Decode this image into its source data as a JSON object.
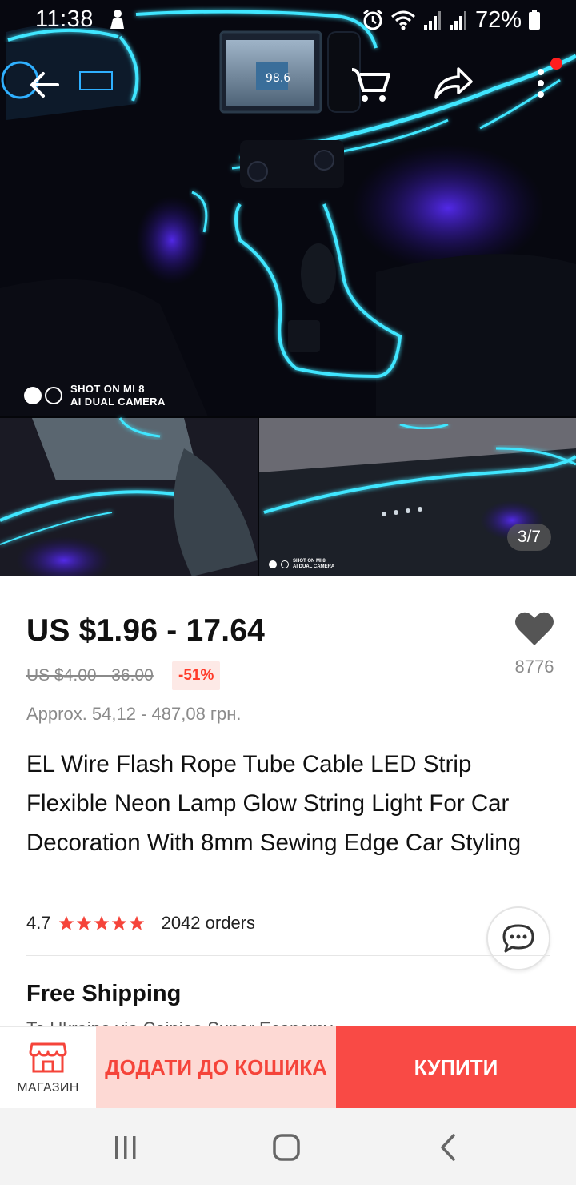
{
  "status_bar": {
    "time": "11:38",
    "battery_percent": "72%"
  },
  "gallery": {
    "counter": "3/7",
    "watermark_line1": "SHOT ON MI 8",
    "watermark_line2": "AI DUAL CAMERA"
  },
  "product": {
    "price": "US $1.96 - 17.64",
    "old_price": "US $4.00 - 36.00",
    "discount": "-51%",
    "approx_price": "Approx. 54,12 - 487,08 грн.",
    "wishlist_count": "8776",
    "title": "EL Wire Flash Rope Tube Cable LED Strip Flexible Neon Lamp Glow String Light For Car Decoration With 8mm Sewing Edge Car Styling",
    "rating": "4.7",
    "stars": 5,
    "orders": "2042 orders",
    "shipping": "Free Shipping",
    "shipping_detail": "To Ukraine via Cainiao Super Economy"
  },
  "action_bar": {
    "store_label": "МАГАЗИН",
    "add_to_cart_label": "ДОДАТИ ДО КОШИКА",
    "buy_label": "КУПИТИ"
  },
  "colors": {
    "accent": "#f94a45",
    "accent_light": "#fdd9d4",
    "star": "#f5443a",
    "neon": "#3fe6ff"
  },
  "icons": [
    "back-arrow-icon",
    "cart-icon",
    "share-icon",
    "more-icon",
    "heart-icon",
    "chat-icon",
    "store-icon",
    "recents-icon",
    "home-icon",
    "nav-back-icon"
  ]
}
